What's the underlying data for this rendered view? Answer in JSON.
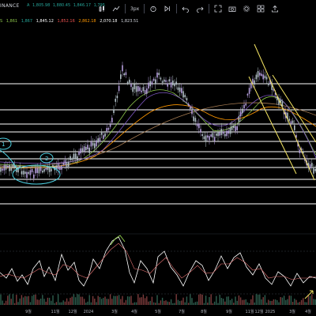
{
  "header": {
    "exchange": "INANCE",
    "ohlc_line": [
      "A",
      "1,805.98",
      "1,880.45",
      "1,846.17",
      "1,795"
    ],
    "ma_legend": [
      "S",
      "1,861",
      "1,867",
      "1,845.12",
      "1,852.16",
      "2,862.18",
      "2,070.18",
      "1,823.51"
    ]
  },
  "toolbar": {
    "items": [
      {
        "name": "bar-style-icon",
        "icon": "candles"
      },
      {
        "name": "indicators-icon",
        "icon": "chart"
      },
      {
        "name": "timeframe-button",
        "label": "3px"
      },
      {
        "name": "alert-icon",
        "icon": "alarm"
      },
      {
        "name": "replay-icon",
        "icon": "replay"
      },
      {
        "name": "undo-icon",
        "icon": "undo"
      },
      {
        "name": "redo-icon",
        "icon": "redo"
      },
      {
        "name": "fullscreen-icon",
        "icon": "expand"
      },
      {
        "name": "screenshot-icon",
        "icon": "camera"
      },
      {
        "name": "settings-icon",
        "icon": "gear"
      },
      {
        "name": "layout-icon",
        "icon": "grid"
      },
      {
        "name": "publish-icon",
        "icon": "upload"
      }
    ]
  },
  "x_axis_labels": [
    "9월",
    "11월",
    "12월",
    "2024",
    "3월",
    "4월",
    "5월",
    "7월",
    "8월",
    "9월",
    "11월",
    "12월",
    "2025",
    "3월",
    "4월"
  ],
  "colors": {
    "background": "#000000",
    "candle_up": "#b39ddb",
    "candle_down": "#b0bec5",
    "horizontal_lines": "#ffffff",
    "trendline": "#f5e663",
    "annotation": "#4dd0e1",
    "ma1": "#8bc34a",
    "ma2": "#ff9800",
    "ma3": "#a67c52",
    "osc_line": "#ffffff",
    "osc_signal": "#e57373"
  },
  "annotations": {
    "circle_1_label": "1",
    "circle_2_label": "2"
  }
}
